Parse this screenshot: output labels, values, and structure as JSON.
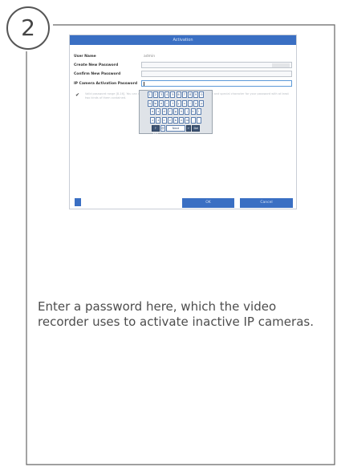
{
  "step": {
    "number": "2"
  },
  "dialog": {
    "title": "Activation",
    "fields": [
      {
        "label": "User Name",
        "value": "admin"
      },
      {
        "label": "Create New Password",
        "value": ""
      },
      {
        "label": "Confirm New Password",
        "value": ""
      },
      {
        "label": "IP Camera Activation Password",
        "value": ""
      }
    ],
    "hint": "Valid password range [8-16]. You can use a combination of numbers, lowercase, uppercase and special character for your password with at least two kinds of them contained.",
    "ok_label": "OK",
    "cancel_label": "Cancel"
  },
  "keyboard": {
    "rows": [
      [
        "1",
        "2",
        "3",
        "4",
        "5",
        "6",
        "7",
        "8",
        "9",
        "0"
      ],
      [
        "q",
        "w",
        "e",
        "r",
        "t",
        "y",
        "u",
        "i",
        "o",
        "p"
      ],
      [
        "a",
        "s",
        "d",
        "f",
        "g",
        "h",
        "j",
        "k",
        "l"
      ],
      [
        "z",
        "x",
        "c",
        "v",
        "b",
        "n",
        "m",
        ",",
        "."
      ],
      [
        "?123",
        "@",
        "Next",
        "←",
        "Del"
      ]
    ]
  },
  "caption": "Enter a password here, which the video recorder uses to activate inactive IP cameras."
}
